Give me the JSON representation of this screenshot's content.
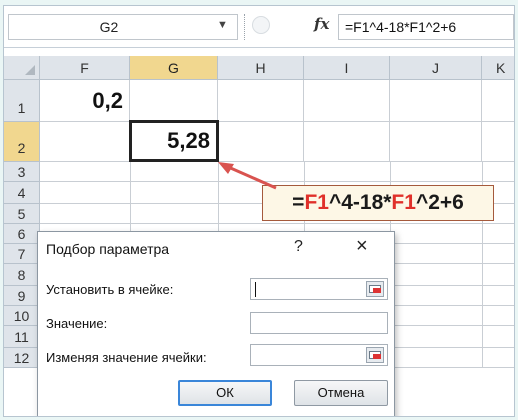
{
  "formula_bar": {
    "name_box": "G2",
    "fx_symbol": "fx",
    "formula": "=F1^4-18*F1^2+6"
  },
  "columns": [
    "F",
    "G",
    "H",
    "I",
    "J",
    "K"
  ],
  "rows": [
    "1",
    "2",
    "3",
    "4",
    "5",
    "6",
    "7",
    "8",
    "9",
    "10",
    "11",
    "12"
  ],
  "cells": {
    "F1": "0,2",
    "G2": "5,28"
  },
  "selection": {
    "column": "G",
    "row": "2"
  },
  "callout": {
    "prefix": "=",
    "ref1": "F1",
    "middle": "^4-18*",
    "ref2": "F1",
    "suffix": "^2+6",
    "ref_color": "#e0302a",
    "border_color": "#a55a3c",
    "arrow_color": "#d9534f"
  },
  "dialog": {
    "title": "Подбор параметра",
    "help": "?",
    "close": "×",
    "set_cell_label": "Установить в ячейке:",
    "set_cell_value": "",
    "to_value_label": "Значение:",
    "to_value_value": "",
    "changing_cell_label": "Изменяя значение ячейки:",
    "changing_cell_value": "",
    "ok_label": "ОК",
    "cancel_label": "Отмена"
  },
  "colors": {
    "selected_header": "#f1d78f",
    "header_bg": "#dfe4ea",
    "ok_focus": "#3a86d9"
  }
}
